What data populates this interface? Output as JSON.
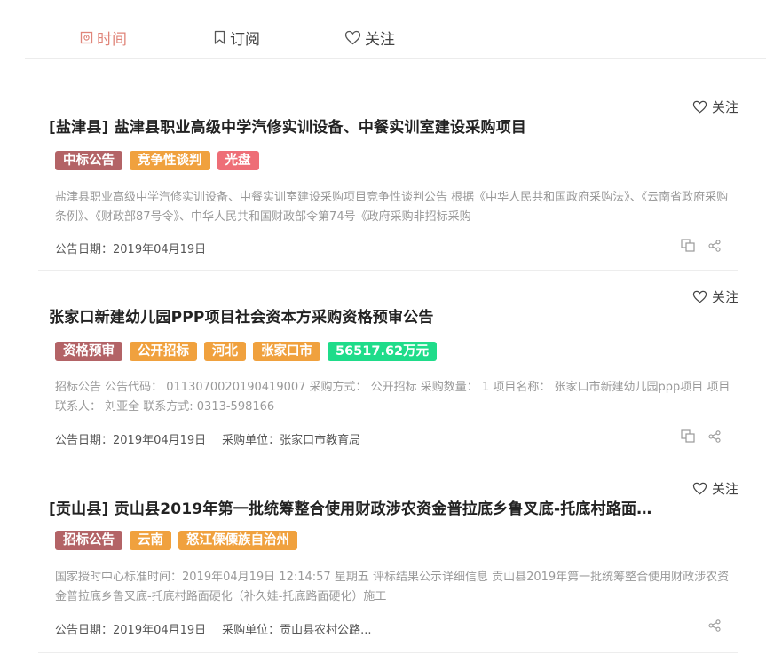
{
  "tabs": [
    {
      "label": "时间",
      "icon": "calendar-icon",
      "active": true
    },
    {
      "label": "订阅",
      "icon": "bookmark-icon",
      "active": false
    },
    {
      "label": "关注",
      "icon": "heart-icon",
      "active": false
    }
  ],
  "colors": {
    "active_tab": "#e0857a",
    "tag_brown": "#b36366",
    "tag_orange": "#f0a13e",
    "tag_pink": "#ee6e77",
    "tag_green": "#1fdc8a"
  },
  "items": [
    {
      "follow_label": "关注",
      "title": "[盐津县] 盐津县职业高级中学汽修实训设备、中餐实训室建设采购项目",
      "tags": [
        {
          "text": "中标公告",
          "color": "#b36366"
        },
        {
          "text": "竞争性谈判",
          "color": "#f0a13e"
        },
        {
          "text": "光盘",
          "color": "#ee6e77"
        }
      ],
      "excerpt": "盐津县职业高级中学汽修实训设备、中餐实训室建设采购项目竞争性谈判公告 根据《中华人民共和国政府采购法》、《云南省政府采购条例》、《财政部87号令》、中华人民共和国财政部令第74号《政府采购非招标采购",
      "date_label": "公告日期：2019年04月19日",
      "unit_label": "",
      "copy_icon": true
    },
    {
      "follow_label": "关注",
      "title": "张家口新建幼儿园PPP项目社会资本方采购资格预审公告",
      "tags": [
        {
          "text": "资格预审",
          "color": "#b36366"
        },
        {
          "text": "公开招标",
          "color": "#f0a13e"
        },
        {
          "text": "河北",
          "color": "#f0a13e"
        },
        {
          "text": "张家口市",
          "color": "#f0a13e"
        },
        {
          "text": "56517.62万元",
          "color": "#1fdc8a"
        }
      ],
      "excerpt": "招标公告 公告代码： 0113070020190419007 采购方式： 公开招标 采购数量： 1 项目名称： 张家口市新建幼儿园ppp项目 项目联系人： 刘亚全 联系方式: 0313-598166",
      "date_label": "公告日期：2019年04月19日",
      "unit_label": "采购单位：张家口市教育局",
      "copy_icon": true
    },
    {
      "follow_label": "关注",
      "title": "[贡山县] 贡山县2019年第一批统筹整合使用财政涉农资金普拉底乡鲁叉底-托底村路面…",
      "tags": [
        {
          "text": "招标公告",
          "color": "#b36366"
        },
        {
          "text": "云南",
          "color": "#f0a13e"
        },
        {
          "text": "怒江傈僳族自治州",
          "color": "#f0a13e"
        }
      ],
      "excerpt": "国家授时中心标准时间：2019年04月19日 12:14:57 星期五 评标结果公示详细信息 贡山县2019年第一批统筹整合使用财政涉农资金普拉底乡鲁叉底-托底村路面硬化（补久娃-托底路面硬化）施工",
      "date_label": "公告日期：2019年04月19日",
      "unit_label": "采购单位：贡山县农村公路...",
      "copy_icon": false
    }
  ]
}
